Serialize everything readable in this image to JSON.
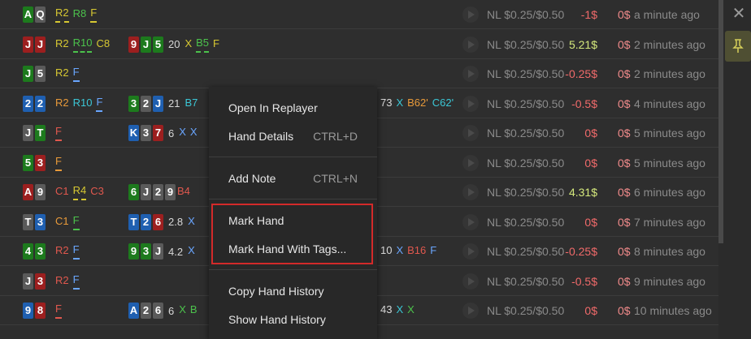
{
  "rows": [
    {
      "hole": [
        {
          "t": "A",
          "c": "green"
        },
        {
          "t": "Q",
          "c": "grey"
        }
      ],
      "acts": [
        {
          "t": "R2",
          "c": "yellow",
          "u": "dash"
        },
        {
          "t": "R8",
          "c": "green"
        },
        {
          "t": "F",
          "c": "yellow",
          "u": "solid"
        }
      ],
      "board": [],
      "pot": "",
      "post": [],
      "stake": "NL $0.25/$0.50",
      "result": "-1$",
      "rc": "neg",
      "zero": "0$",
      "time": "a minute ago"
    },
    {
      "hole": [
        {
          "t": "J",
          "c": "red"
        },
        {
          "t": "J",
          "c": "red"
        }
      ],
      "acts": [
        {
          "t": "R2",
          "c": "yellow"
        },
        {
          "t": "R10",
          "c": "green",
          "u": "dash"
        },
        {
          "t": "C8",
          "c": "yellow"
        }
      ],
      "board": [
        {
          "t": "9",
          "c": "red"
        },
        {
          "t": "J",
          "c": "green"
        },
        {
          "t": "5",
          "c": "green"
        }
      ],
      "pot": "20",
      "post": [
        {
          "t": "X",
          "c": "yellow"
        },
        {
          "t": "B5",
          "c": "green",
          "u": "dash"
        },
        {
          "t": "F",
          "c": "yellow"
        }
      ],
      "stake": "NL $0.25/$0.50",
      "result": "5.21$",
      "rc": "pos",
      "zero": "0$",
      "time": "2 minutes ago"
    },
    {
      "hole": [
        {
          "t": "J",
          "c": "green"
        },
        {
          "t": "5",
          "c": "grey"
        }
      ],
      "acts": [
        {
          "t": "R2",
          "c": "yellow"
        },
        {
          "t": "F",
          "c": "blue",
          "u": "solid"
        }
      ],
      "board": [],
      "pot": "",
      "post": [],
      "stake": "NL $0.25/$0.50",
      "result": "-0.25$",
      "rc": "neg",
      "zero": "0$",
      "time": "2 minutes ago"
    },
    {
      "hole": [
        {
          "t": "2",
          "c": "blue"
        },
        {
          "t": "2",
          "c": "blue"
        }
      ],
      "acts": [
        {
          "t": "R2",
          "c": "orange"
        },
        {
          "t": "R10",
          "c": "cyan"
        },
        {
          "t": "F",
          "c": "blue",
          "u": "solid"
        }
      ],
      "board": [
        {
          "t": "3",
          "c": "green"
        },
        {
          "t": "2",
          "c": "grey"
        },
        {
          "t": "J",
          "c": "blue"
        }
      ],
      "pot": "21",
      "post": [
        {
          "t": "B7",
          "c": "cyan"
        }
      ],
      "tail": [
        {
          "t": "73",
          "c": "white"
        },
        {
          "t": "X",
          "c": "cyan"
        },
        {
          "t": "B62'",
          "c": "orange"
        },
        {
          "t": "C62'",
          "c": "cyan"
        }
      ],
      "stake": "NL $0.25/$0.50",
      "result": "-0.5$",
      "rc": "neg",
      "zero": "0$",
      "time": "4 minutes ago"
    },
    {
      "hole": [
        {
          "t": "J",
          "c": "grey"
        },
        {
          "t": "T",
          "c": "green"
        }
      ],
      "acts": [
        {
          "t": "F",
          "c": "red",
          "u": "solid"
        }
      ],
      "board": [
        {
          "t": "K",
          "c": "blue"
        },
        {
          "t": "3",
          "c": "grey"
        },
        {
          "t": "7",
          "c": "red"
        }
      ],
      "pot": "6",
      "post": [
        {
          "t": "X",
          "c": "blue"
        },
        {
          "t": "X",
          "c": "blue"
        }
      ],
      "stake": "NL $0.25/$0.50",
      "result": "0$",
      "rc": "neg",
      "zero": "0$",
      "time": "5 minutes ago"
    },
    {
      "hole": [
        {
          "t": "5",
          "c": "green"
        },
        {
          "t": "3",
          "c": "red"
        }
      ],
      "acts": [
        {
          "t": "F",
          "c": "orange",
          "u": "solid"
        }
      ],
      "board": [],
      "pot": "",
      "post": [],
      "stake": "NL $0.25/$0.50",
      "result": "0$",
      "rc": "neg",
      "zero": "0$",
      "time": "5 minutes ago"
    },
    {
      "hole": [
        {
          "t": "A",
          "c": "red"
        },
        {
          "t": "9",
          "c": "grey"
        }
      ],
      "acts": [
        {
          "t": "C1",
          "c": "red"
        },
        {
          "t": "R4",
          "c": "yellow",
          "u": "dash"
        },
        {
          "t": "C3",
          "c": "red"
        }
      ],
      "board": [
        {
          "t": "6",
          "c": "green"
        },
        {
          "t": "J",
          "c": "grey"
        },
        {
          "t": "2",
          "c": "grey"
        },
        {
          "t": "9",
          "c": "grey"
        }
      ],
      "pot": "",
      "post": [
        {
          "t": "B4",
          "c": "red"
        }
      ],
      "stake": "NL $0.25/$0.50",
      "result": "4.31$",
      "rc": "pos",
      "zero": "0$",
      "time": "6 minutes ago"
    },
    {
      "hole": [
        {
          "t": "T",
          "c": "grey"
        },
        {
          "t": "3",
          "c": "blue"
        }
      ],
      "acts": [
        {
          "t": "C1",
          "c": "orange"
        },
        {
          "t": "F",
          "c": "green",
          "u": "solid"
        }
      ],
      "board": [
        {
          "t": "T",
          "c": "blue"
        },
        {
          "t": "2",
          "c": "blue"
        },
        {
          "t": "6",
          "c": "red"
        }
      ],
      "pot": "2.8",
      "post": [
        {
          "t": "X",
          "c": "blue"
        }
      ],
      "stake": "NL $0.25/$0.50",
      "result": "0$",
      "rc": "neg",
      "zero": "0$",
      "time": "7 minutes ago"
    },
    {
      "hole": [
        {
          "t": "4",
          "c": "green"
        },
        {
          "t": "3",
          "c": "green"
        }
      ],
      "acts": [
        {
          "t": "R2",
          "c": "red"
        },
        {
          "t": "F",
          "c": "blue",
          "u": "solid"
        }
      ],
      "board": [
        {
          "t": "9",
          "c": "green"
        },
        {
          "t": "3",
          "c": "green"
        },
        {
          "t": "J",
          "c": "grey"
        }
      ],
      "pot": "4.2",
      "post": [
        {
          "t": "X",
          "c": "blue"
        }
      ],
      "tail": [
        {
          "t": "10",
          "c": "white"
        },
        {
          "t": "X",
          "c": "blue"
        },
        {
          "t": "B16",
          "c": "red"
        },
        {
          "t": "F",
          "c": "blue"
        }
      ],
      "stake": "NL $0.25/$0.50",
      "result": "-0.25$",
      "rc": "neg",
      "zero": "0$",
      "time": "8 minutes ago"
    },
    {
      "hole": [
        {
          "t": "J",
          "c": "grey"
        },
        {
          "t": "3",
          "c": "red"
        }
      ],
      "acts": [
        {
          "t": "R2",
          "c": "red"
        },
        {
          "t": "F",
          "c": "blue",
          "u": "solid"
        }
      ],
      "board": [],
      "pot": "",
      "post": [],
      "stake": "NL $0.25/$0.50",
      "result": "-0.5$",
      "rc": "neg",
      "zero": "0$",
      "time": "9 minutes ago"
    },
    {
      "hole": [
        {
          "t": "9",
          "c": "blue"
        },
        {
          "t": "8",
          "c": "red"
        }
      ],
      "acts": [
        {
          "t": "F",
          "c": "red",
          "u": "solid"
        }
      ],
      "board": [
        {
          "t": "A",
          "c": "blue"
        },
        {
          "t": "2",
          "c": "grey"
        },
        {
          "t": "6",
          "c": "grey"
        }
      ],
      "pot": "6",
      "post": [
        {
          "t": "X",
          "c": "green"
        },
        {
          "t": "B",
          "c": "green"
        }
      ],
      "tail": [
        {
          "t": "43",
          "c": "white"
        },
        {
          "t": "X",
          "c": "cyan"
        },
        {
          "t": "X",
          "c": "green"
        }
      ],
      "stake": "NL $0.25/$0.50",
      "result": "0$",
      "rc": "neg",
      "zero": "0$",
      "time": "10 minutes ago"
    }
  ],
  "context_menu": {
    "items": [
      {
        "label": "Open In Replayer",
        "shortcut": ""
      },
      {
        "label": "Hand Details",
        "shortcut": "CTRL+D"
      },
      {
        "label": "Add Note",
        "shortcut": "CTRL+N"
      },
      {
        "label": "Mark Hand",
        "shortcut": ""
      },
      {
        "label": "Mark Hand With Tags...",
        "shortcut": ""
      },
      {
        "label": "Copy Hand History",
        "shortcut": ""
      },
      {
        "label": "Show Hand History",
        "shortcut": ""
      }
    ]
  },
  "side": {
    "close_icon": "close-icon",
    "pin_icon": "pin-icon",
    "pin_bg": "#4f4f33"
  },
  "colors": {
    "card_green": "#1d7a1d",
    "card_red": "#9c1f1f",
    "card_grey": "#5a5a5a",
    "card_blue": "#1f5fb0",
    "highlight": "#d32a2a"
  }
}
